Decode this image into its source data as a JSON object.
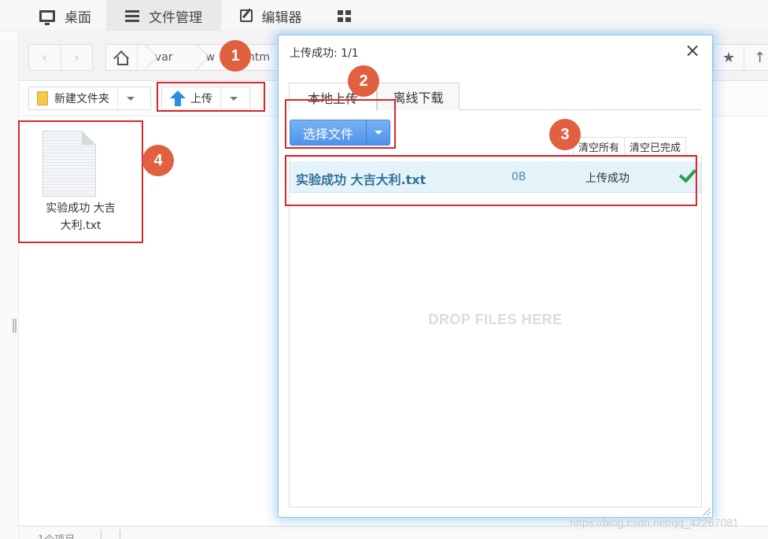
{
  "topbar": {
    "tabs": [
      {
        "label": "桌面",
        "icon": "monitor-icon"
      },
      {
        "label": "文件管理",
        "icon": "list-icon"
      },
      {
        "label": "编辑器",
        "icon": "edit-icon"
      },
      {
        "label": "",
        "icon": "grid-icon"
      }
    ]
  },
  "address": {
    "back": "‹",
    "forward": "›",
    "crumbs": [
      "var",
      "w",
      "htm"
    ],
    "star": "★",
    "up": "↑"
  },
  "toolbar": {
    "new_folder": "新建文件夹",
    "upload": "上传"
  },
  "file": {
    "name_line1": "实验成功 大吉",
    "name_line2": "大利.txt"
  },
  "status": {
    "item_count": "1个项目"
  },
  "dialog": {
    "title": "上传成功: 1/1",
    "close": "×",
    "tabs": [
      "本地上传",
      "离线下载"
    ],
    "select_files": "选择文件",
    "clear_all": "清空所有",
    "clear_done": "清空已完成",
    "rows": [
      {
        "name": "实验成功 大吉大利.txt",
        "size": "0B",
        "status": "上传成功"
      }
    ],
    "drop_hint": "DROP FILES HERE"
  },
  "annotations": [
    "1",
    "2",
    "3",
    "4"
  ],
  "watermark": "https://blog.csdn.net/qq_42267081",
  "colors": {
    "annotation_red": "#d9272e",
    "badge_orange": "#e06040",
    "primary_blue": "#4d93e9",
    "success_green": "#2e9c4c"
  }
}
